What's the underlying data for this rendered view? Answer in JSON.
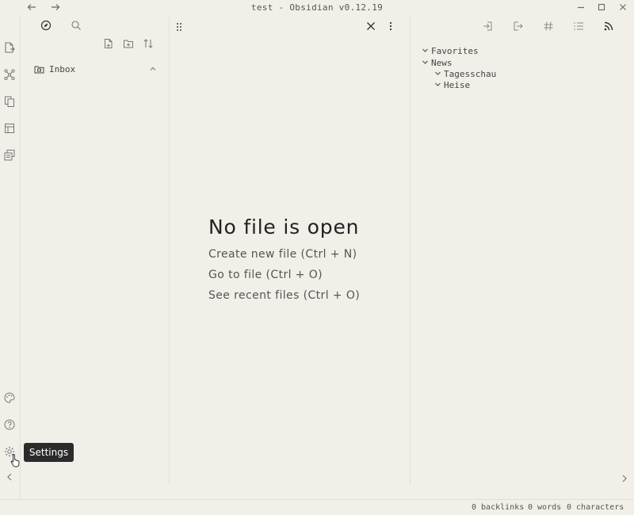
{
  "window": {
    "title": "test - Obsidian v0.12.19",
    "back_icon": "arrow-left-icon",
    "forward_icon": "arrow-right-icon"
  },
  "ribbon": {
    "icons": [
      "open-file-icon",
      "graph-view-icon",
      "copy-icon",
      "templates-icon",
      "daily-notes-icon"
    ],
    "bottom_icons": [
      "palette-icon",
      "help-icon",
      "settings-icon"
    ]
  },
  "left_sidebar": {
    "tabs": [
      "file-explorer-icon",
      "search-icon"
    ],
    "actions": [
      "new-note-icon",
      "new-folder-icon",
      "sort-icon"
    ],
    "folders": [
      {
        "name": "Inbox"
      }
    ]
  },
  "center": {
    "title": "No file is open",
    "actions": [
      "Create new file (Ctrl + N)",
      "Go to file (Ctrl + O)",
      "See recent files (Ctrl + O)"
    ]
  },
  "right_sidebar": {
    "tabs": [
      "backlinks-icon",
      "outgoing-links-icon",
      "tags-icon",
      "outline-icon",
      "rss-icon"
    ],
    "tree": {
      "favorites": "Favorites",
      "news": "News",
      "children": [
        "Tagesschau",
        "Heise"
      ]
    }
  },
  "status": {
    "backlinks": "0 backlinks",
    "words": "0 words",
    "characters": "0 characters"
  },
  "tooltip": {
    "text": "Settings"
  },
  "colors": {
    "background": "#f2efe9",
    "tooltip": "#2b2b2b",
    "border": "#e2dfd9"
  }
}
